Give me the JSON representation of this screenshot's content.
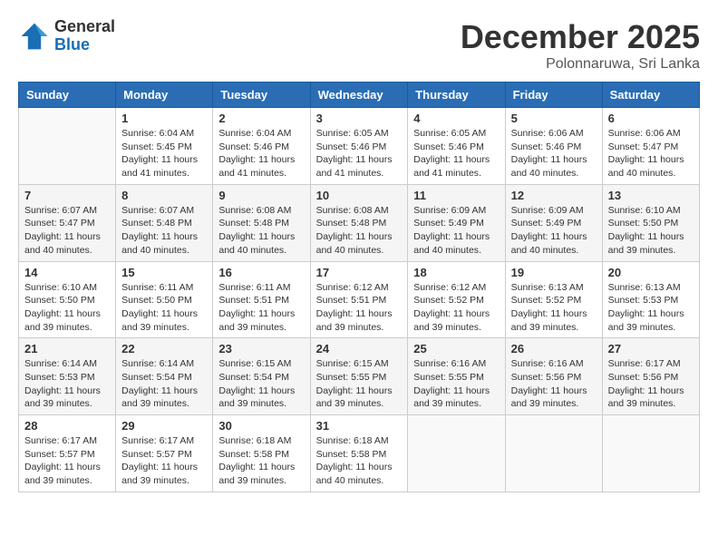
{
  "header": {
    "logo": {
      "general": "General",
      "blue": "Blue"
    },
    "title": "December 2025",
    "location": "Polonnaruwa, Sri Lanka"
  },
  "weekdays": [
    "Sunday",
    "Monday",
    "Tuesday",
    "Wednesday",
    "Thursday",
    "Friday",
    "Saturday"
  ],
  "weeks": [
    [
      {
        "day": "",
        "info": ""
      },
      {
        "day": "1",
        "info": "Sunrise: 6:04 AM\nSunset: 5:45 PM\nDaylight: 11 hours and 41 minutes."
      },
      {
        "day": "2",
        "info": "Sunrise: 6:04 AM\nSunset: 5:46 PM\nDaylight: 11 hours and 41 minutes."
      },
      {
        "day": "3",
        "info": "Sunrise: 6:05 AM\nSunset: 5:46 PM\nDaylight: 11 hours and 41 minutes."
      },
      {
        "day": "4",
        "info": "Sunrise: 6:05 AM\nSunset: 5:46 PM\nDaylight: 11 hours and 41 minutes."
      },
      {
        "day": "5",
        "info": "Sunrise: 6:06 AM\nSunset: 5:46 PM\nDaylight: 11 hours and 40 minutes."
      },
      {
        "day": "6",
        "info": "Sunrise: 6:06 AM\nSunset: 5:47 PM\nDaylight: 11 hours and 40 minutes."
      }
    ],
    [
      {
        "day": "7",
        "info": "Sunrise: 6:07 AM\nSunset: 5:47 PM\nDaylight: 11 hours and 40 minutes."
      },
      {
        "day": "8",
        "info": "Sunrise: 6:07 AM\nSunset: 5:48 PM\nDaylight: 11 hours and 40 minutes."
      },
      {
        "day": "9",
        "info": "Sunrise: 6:08 AM\nSunset: 5:48 PM\nDaylight: 11 hours and 40 minutes."
      },
      {
        "day": "10",
        "info": "Sunrise: 6:08 AM\nSunset: 5:48 PM\nDaylight: 11 hours and 40 minutes."
      },
      {
        "day": "11",
        "info": "Sunrise: 6:09 AM\nSunset: 5:49 PM\nDaylight: 11 hours and 40 minutes."
      },
      {
        "day": "12",
        "info": "Sunrise: 6:09 AM\nSunset: 5:49 PM\nDaylight: 11 hours and 40 minutes."
      },
      {
        "day": "13",
        "info": "Sunrise: 6:10 AM\nSunset: 5:50 PM\nDaylight: 11 hours and 39 minutes."
      }
    ],
    [
      {
        "day": "14",
        "info": "Sunrise: 6:10 AM\nSunset: 5:50 PM\nDaylight: 11 hours and 39 minutes."
      },
      {
        "day": "15",
        "info": "Sunrise: 6:11 AM\nSunset: 5:50 PM\nDaylight: 11 hours and 39 minutes."
      },
      {
        "day": "16",
        "info": "Sunrise: 6:11 AM\nSunset: 5:51 PM\nDaylight: 11 hours and 39 minutes."
      },
      {
        "day": "17",
        "info": "Sunrise: 6:12 AM\nSunset: 5:51 PM\nDaylight: 11 hours and 39 minutes."
      },
      {
        "day": "18",
        "info": "Sunrise: 6:12 AM\nSunset: 5:52 PM\nDaylight: 11 hours and 39 minutes."
      },
      {
        "day": "19",
        "info": "Sunrise: 6:13 AM\nSunset: 5:52 PM\nDaylight: 11 hours and 39 minutes."
      },
      {
        "day": "20",
        "info": "Sunrise: 6:13 AM\nSunset: 5:53 PM\nDaylight: 11 hours and 39 minutes."
      }
    ],
    [
      {
        "day": "21",
        "info": "Sunrise: 6:14 AM\nSunset: 5:53 PM\nDaylight: 11 hours and 39 minutes."
      },
      {
        "day": "22",
        "info": "Sunrise: 6:14 AM\nSunset: 5:54 PM\nDaylight: 11 hours and 39 minutes."
      },
      {
        "day": "23",
        "info": "Sunrise: 6:15 AM\nSunset: 5:54 PM\nDaylight: 11 hours and 39 minutes."
      },
      {
        "day": "24",
        "info": "Sunrise: 6:15 AM\nSunset: 5:55 PM\nDaylight: 11 hours and 39 minutes."
      },
      {
        "day": "25",
        "info": "Sunrise: 6:16 AM\nSunset: 5:55 PM\nDaylight: 11 hours and 39 minutes."
      },
      {
        "day": "26",
        "info": "Sunrise: 6:16 AM\nSunset: 5:56 PM\nDaylight: 11 hours and 39 minutes."
      },
      {
        "day": "27",
        "info": "Sunrise: 6:17 AM\nSunset: 5:56 PM\nDaylight: 11 hours and 39 minutes."
      }
    ],
    [
      {
        "day": "28",
        "info": "Sunrise: 6:17 AM\nSunset: 5:57 PM\nDaylight: 11 hours and 39 minutes."
      },
      {
        "day": "29",
        "info": "Sunrise: 6:17 AM\nSunset: 5:57 PM\nDaylight: 11 hours and 39 minutes."
      },
      {
        "day": "30",
        "info": "Sunrise: 6:18 AM\nSunset: 5:58 PM\nDaylight: 11 hours and 39 minutes."
      },
      {
        "day": "31",
        "info": "Sunrise: 6:18 AM\nSunset: 5:58 PM\nDaylight: 11 hours and 40 minutes."
      },
      {
        "day": "",
        "info": ""
      },
      {
        "day": "",
        "info": ""
      },
      {
        "day": "",
        "info": ""
      }
    ]
  ]
}
